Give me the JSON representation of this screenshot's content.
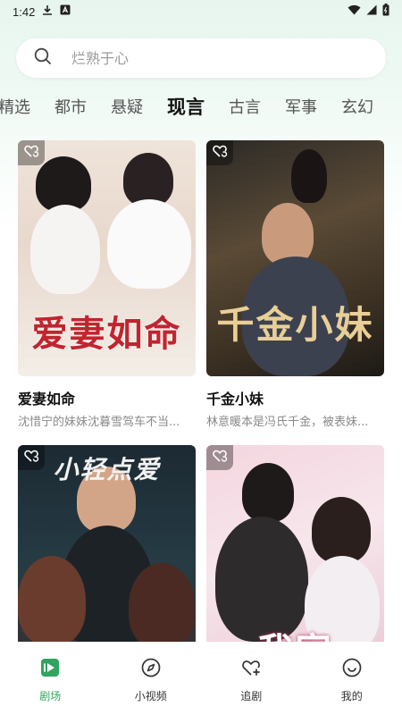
{
  "status_bar": {
    "time": "1:42",
    "icons": [
      "download-icon",
      "a-box-icon",
      "wifi-icon",
      "signal-icon",
      "battery-icon"
    ]
  },
  "search": {
    "placeholder": "烂熟于心"
  },
  "tabs": [
    {
      "label": "精选",
      "active": false
    },
    {
      "label": "都市",
      "active": false
    },
    {
      "label": "悬疑",
      "active": false
    },
    {
      "label": "现言",
      "active": true
    },
    {
      "label": "古言",
      "active": false
    },
    {
      "label": "军事",
      "active": false
    },
    {
      "label": "玄幻",
      "active": false
    }
  ],
  "cards": [
    {
      "title": "爱妻如命",
      "description": "沈惜宁的妹妹沈暮雪驾车不当...",
      "poster_title": "爱妻如命",
      "badge_icon": "heart-refresh-icon"
    },
    {
      "title": "千金小妹",
      "description": "林意暖本是冯氏千金，被表妹...",
      "poster_title": "千金小妹",
      "badge_icon": "heart-refresh-icon"
    },
    {
      "title": "",
      "description": "",
      "poster_title": "小轻点爱",
      "badge_icon": "heart-refresh-icon"
    },
    {
      "title": "",
      "description": "",
      "poster_title": "我家",
      "badge_icon": "heart-refresh-icon"
    }
  ],
  "bottom_nav": [
    {
      "label": "剧场",
      "icon": "play-square-icon",
      "active": true
    },
    {
      "label": "小视频",
      "icon": "compass-icon",
      "active": false
    },
    {
      "label": "追剧",
      "icon": "heart-plus-icon",
      "active": false
    },
    {
      "label": "我的",
      "icon": "smile-face-icon",
      "active": false
    }
  ],
  "colors": {
    "accent": "#2fa55f",
    "background_top": "#e7f5ee"
  }
}
